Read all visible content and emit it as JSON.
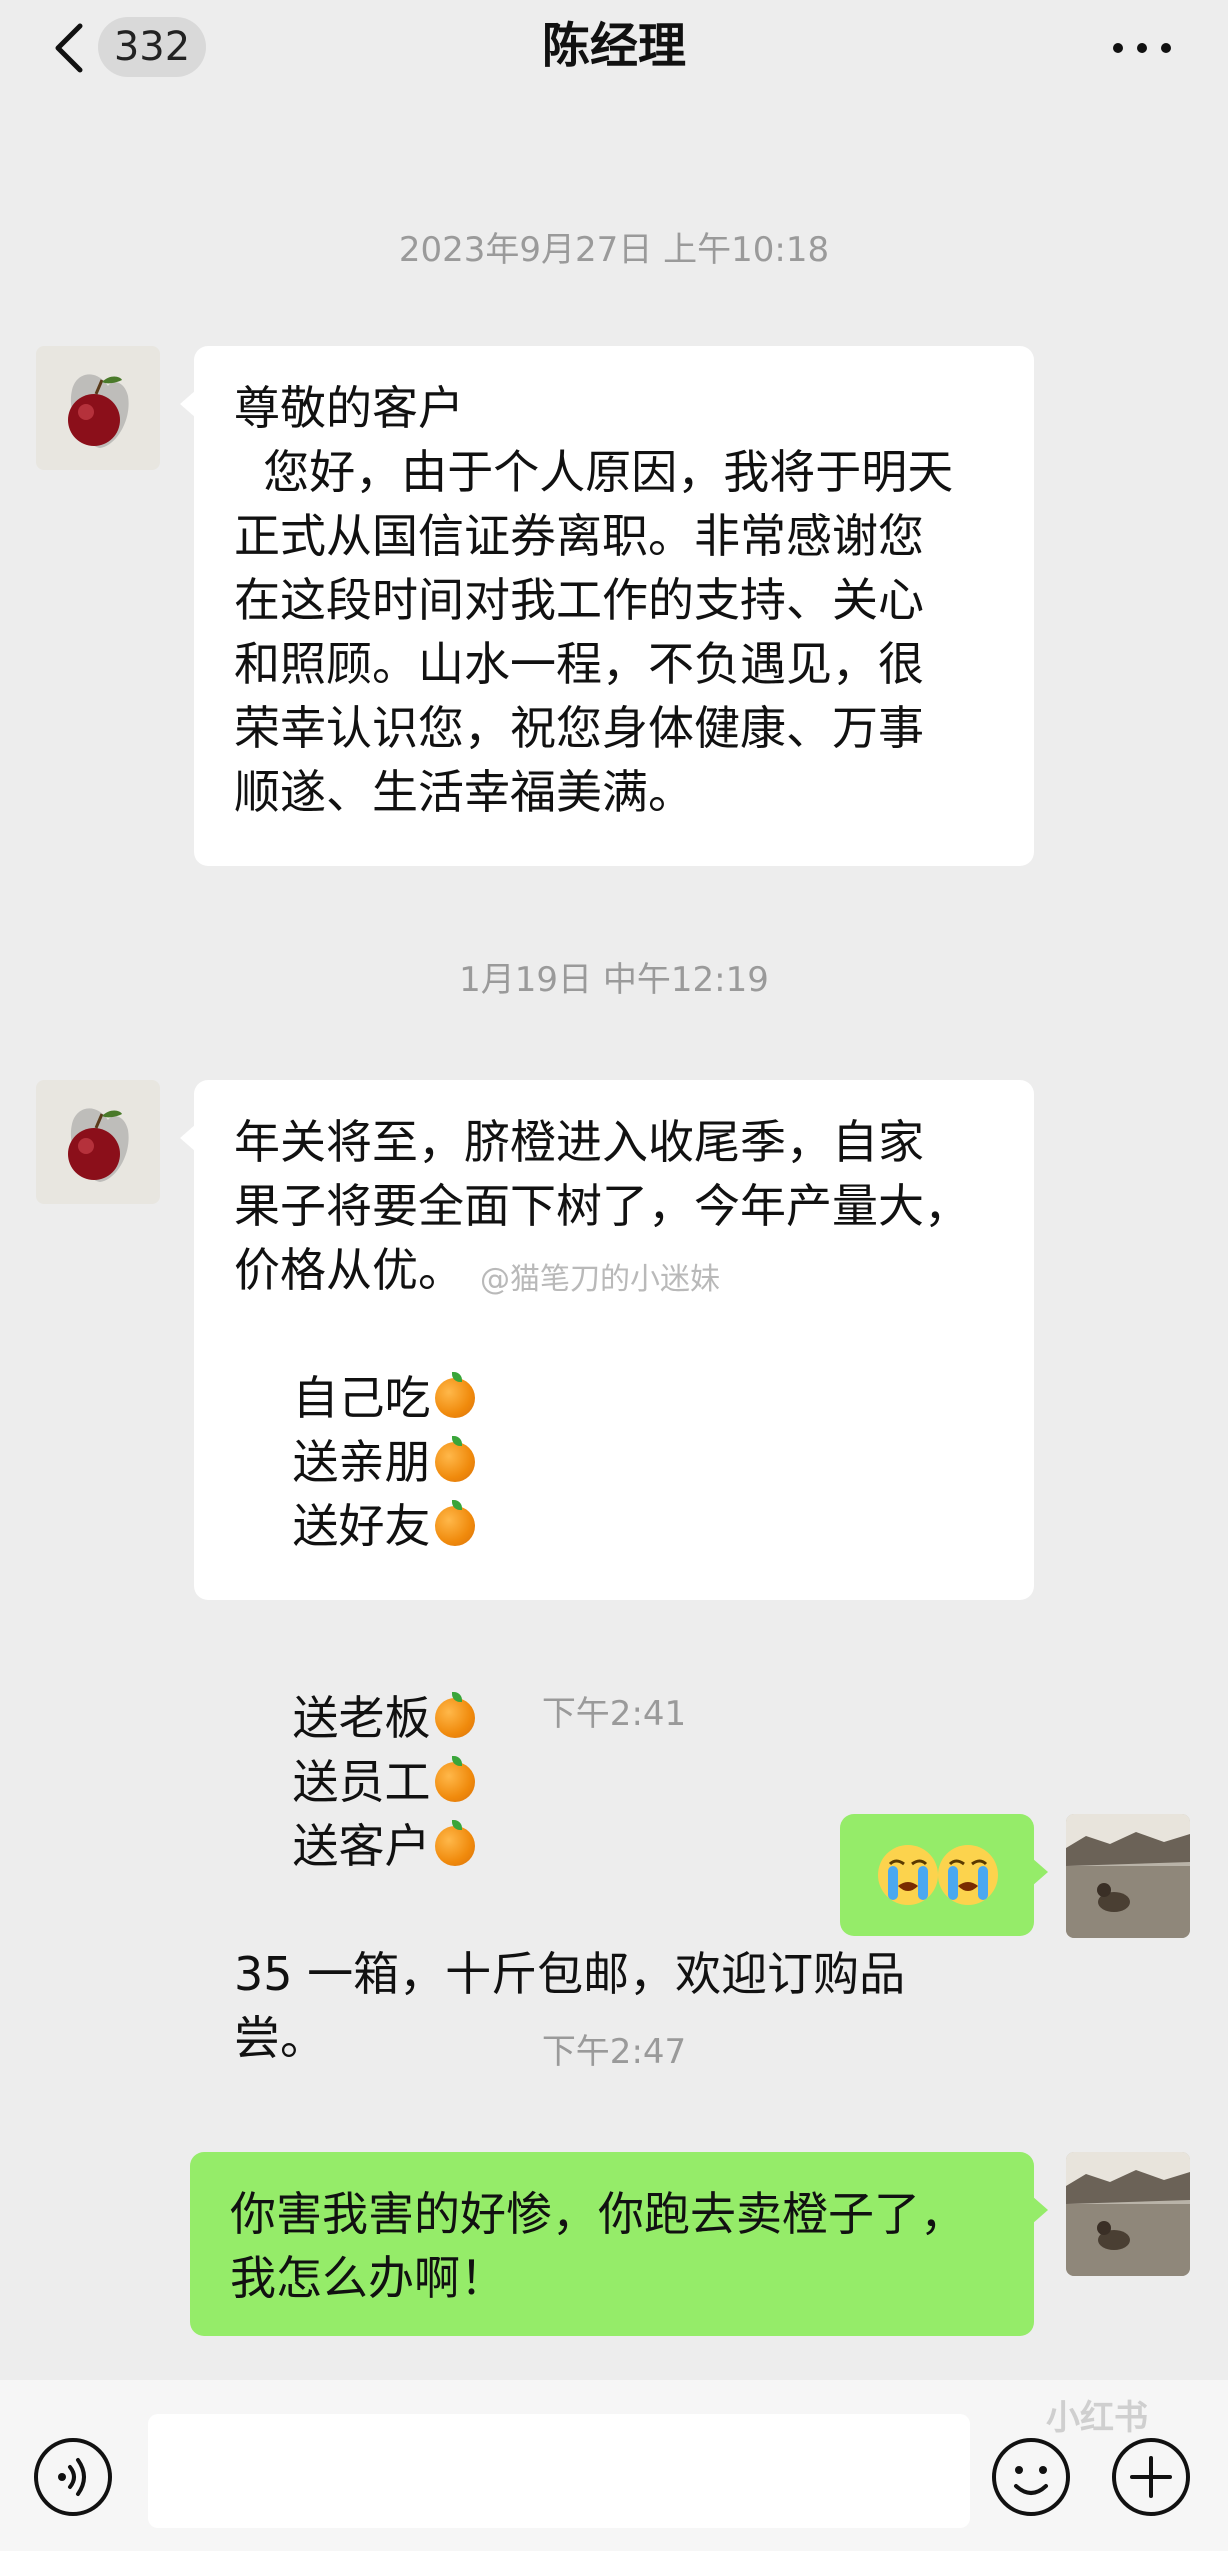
{
  "header": {
    "unread_count": "332",
    "contact_name": "陈经理"
  },
  "messages": [
    {
      "type": "time",
      "text": "2023年9月27日 上午10:18"
    },
    {
      "type": "incoming",
      "lines": [
        "尊敬的客户",
        "  您好，由于个人原因，我将于明天",
        "正式从国信证券离职。非常感谢您",
        "在这段时间对我工作的支持、关心",
        "和照顾。山水一程，不负遇见，很",
        "荣幸认识您，祝您身体健康、万事",
        "顺遂、生活幸福美满。"
      ]
    },
    {
      "type": "time",
      "text": "1月19日 中午12:19"
    },
    {
      "type": "incoming",
      "lines": [
        "年关将至，脐橙进入收尾季，自家",
        "果子将要全面下树了，今年产量大，",
        "价格从优。"
      ],
      "line4": [
        "自己吃",
        "送亲朋",
        "送好友"
      ],
      "line5": [
        "送老板",
        "送员工",
        "送客户"
      ],
      "tail": [
        "35 一箱，十斤包邮，欢迎订购品",
        "尝。"
      ],
      "emoji": "orange"
    },
    {
      "type": "time",
      "text": "下午2:41"
    },
    {
      "type": "outgoing",
      "emoji": "loudly-crying-face x2"
    },
    {
      "type": "time",
      "text": "下午2:47"
    },
    {
      "type": "outgoing",
      "lines": [
        "你害我害的好惨，你跑去卖橙子了，",
        "我怎么办啊！"
      ]
    }
  ],
  "watermark": "@猫笔刀的小迷妹",
  "brand_mark": "小红书",
  "colors": {
    "background": "#ededed",
    "incoming_bubble": "#ffffff",
    "outgoing_bubble": "#95ec69",
    "time_text": "#9a9a9a"
  }
}
